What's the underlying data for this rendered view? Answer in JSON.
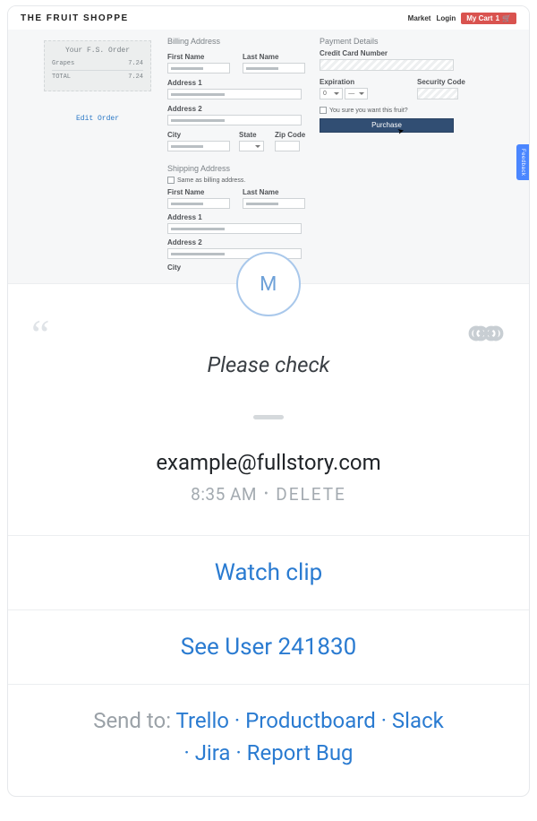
{
  "preview": {
    "brand": "THE FRUIT SHOPPE",
    "top_links": {
      "market": "Market",
      "login": "Login"
    },
    "cart": {
      "label": "My Cart",
      "count": "1"
    },
    "order_box": {
      "title": "Your F.S. Order",
      "item_label": "Grapes",
      "item_price": "7.24",
      "total_label": "TOTAL",
      "total_price": "7.24",
      "edit": "Edit Order"
    },
    "billing": {
      "title": "Billing Address",
      "first_name": "First Name",
      "last_name": "Last Name",
      "address1": "Address 1",
      "address2": "Address 2",
      "city": "City",
      "state": "State",
      "zip": "Zip Code"
    },
    "payment": {
      "title": "Payment Details",
      "cc": "Credit Card Number",
      "exp": "Expiration",
      "sec": "Security Code",
      "confirm": "You sure you want this fruit?",
      "purchase": "Purchase",
      "exp_month": "0",
      "exp_year": "—"
    },
    "shipping": {
      "title": "Shipping Address",
      "same": "Same as billing address.",
      "first_name": "First Name",
      "last_name": "Last Name",
      "address1": "Address 1",
      "address2": "Address 2",
      "city": "City"
    },
    "feedback": "Feedback"
  },
  "avatar_initial": "M",
  "note_text": "Please check",
  "email": "example@fullstory.com",
  "timestamp": "8:35 AM",
  "delete_label": "DELETE",
  "watch_clip": "Watch clip",
  "see_user": "See User 241830",
  "send": {
    "prefix": "Send to:",
    "trello": "Trello",
    "productboard": "Productboard",
    "slack": "Slack",
    "jira": "Jira",
    "report_bug": "Report Bug"
  }
}
